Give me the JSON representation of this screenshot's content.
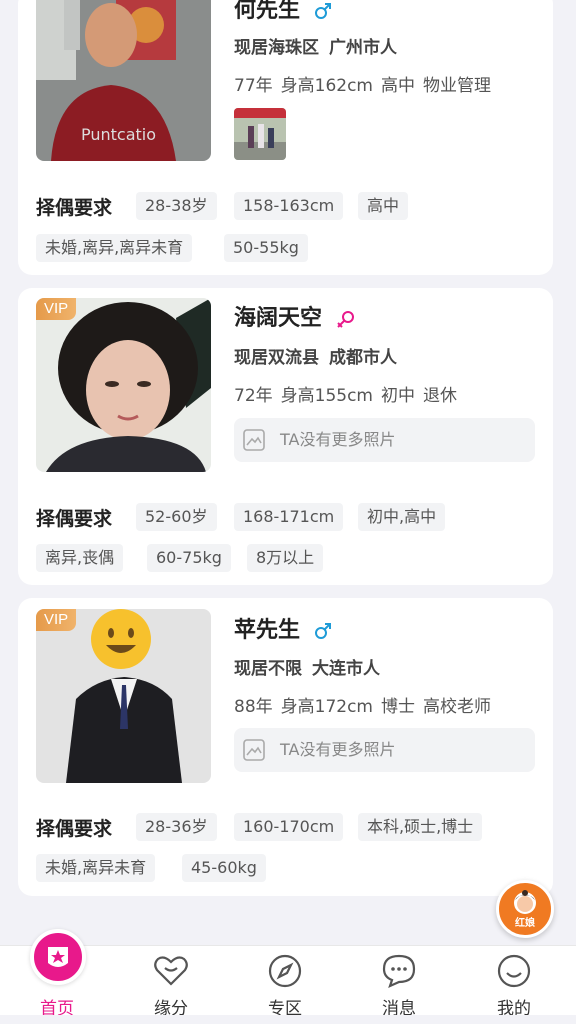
{
  "cards": [
    {
      "name": "何先生",
      "gender": "male",
      "vip": false,
      "residence_district": "现居海珠区",
      "hometown": "广州市人",
      "birth_year": "77年",
      "height": "身高162cm",
      "education": "高中",
      "occupation": "物业管理",
      "photos_note": "",
      "requirements_label": "择偶要求",
      "requirements": [
        "28-38岁",
        "158-163cm",
        "高中",
        "未婚,离异,离异未育",
        "50-55kg"
      ]
    },
    {
      "name": "海阔天空",
      "gender": "female",
      "vip": true,
      "vip_label": "VIP",
      "residence_district": "现居双流县",
      "hometown": "成都市人",
      "birth_year": "72年",
      "height": "身高155cm",
      "education": "初中",
      "occupation": "退休",
      "photos_note": "TA没有更多照片",
      "requirements_label": "择偶要求",
      "requirements": [
        "52-60岁",
        "168-171cm",
        "初中,高中",
        "离异,丧偶",
        "60-75kg",
        "8万以上"
      ]
    },
    {
      "name": "苹先生",
      "gender": "male",
      "vip": true,
      "vip_label": "VIP",
      "residence_district": "现居不限",
      "hometown": "大连市人",
      "birth_year": "88年",
      "height": "身高172cm",
      "education": "博士",
      "occupation": "高校老师",
      "photos_note": "TA没有更多照片",
      "requirements_label": "择偶要求",
      "requirements": [
        "28-36岁",
        "160-170cm",
        "本科,硕士,博士",
        "未婚,离异未育",
        "45-60kg"
      ]
    }
  ],
  "float_button": {
    "label": "红娘",
    "icon": "matchmaker-avatar-icon"
  },
  "tabbar": [
    {
      "label": "首页",
      "icon": "home-star-icon",
      "active": true
    },
    {
      "label": "缘分",
      "icon": "heart-icon",
      "active": false
    },
    {
      "label": "专区",
      "icon": "compass-icon",
      "active": false
    },
    {
      "label": "消息",
      "icon": "chat-bubble-icon",
      "active": false
    },
    {
      "label": "我的",
      "icon": "smiley-icon",
      "active": false
    }
  ],
  "colors": {
    "accent": "#e8198b",
    "male": "#1e9bd7",
    "female": "#e8198b",
    "vip": "#e59a4a",
    "matchmaker": "#f07a22"
  }
}
